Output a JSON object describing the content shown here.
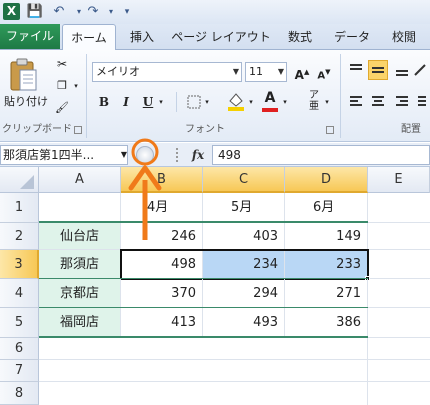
{
  "qat": {
    "excel_icon": "X"
  },
  "tabs": [
    "ファイル",
    "ホーム",
    "挿入",
    "ページ レイアウト",
    "数式",
    "データ",
    "校閲"
  ],
  "ribbon": {
    "paste_label": "貼り付け",
    "clipboard_label": "クリップボード",
    "font_name": "メイリオ",
    "font_size": "11",
    "bold": "B",
    "italic": "I",
    "underline": "U",
    "font_group_label": "フォント",
    "align_group_label": "配置",
    "font_color_letter": "A",
    "fill_color": "#f5d000",
    "font_color": "#e02020"
  },
  "formula_bar": {
    "name_box": "那須店第1四半...",
    "fx": "fx",
    "value": "498"
  },
  "columns": [
    "A",
    "B",
    "C",
    "D",
    "E"
  ],
  "rows": [
    "1",
    "2",
    "3",
    "4",
    "5",
    "6",
    "7",
    "8"
  ],
  "sheet": {
    "headers": [
      "4月",
      "5月",
      "6月"
    ],
    "data": [
      {
        "store": "仙台店",
        "values": [
          "246",
          "403",
          "149"
        ]
      },
      {
        "store": "那須店",
        "values": [
          "498",
          "234",
          "233"
        ]
      },
      {
        "store": "京都店",
        "values": [
          "370",
          "294",
          "271"
        ]
      },
      {
        "store": "福岡店",
        "values": [
          "413",
          "493",
          "386"
        ]
      }
    ]
  },
  "colors": {
    "arrow": "#f07a1a",
    "selection": "#b9d7f5",
    "store_fill": "#dff3ea",
    "table_border": "#3a8a6a"
  }
}
